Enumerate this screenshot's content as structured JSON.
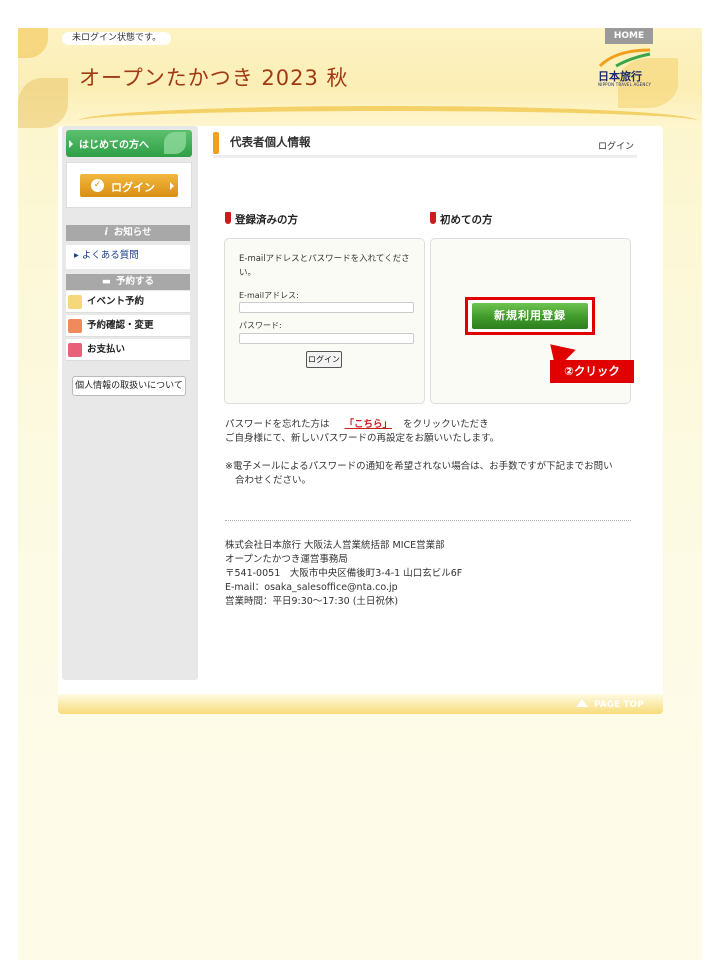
{
  "header": {
    "login_status": "未ログイン状態です。",
    "site_title": "オープンたかつき 2023 秋",
    "home_label": "HOME",
    "brand_name": "日本旅行",
    "brand_sub": "NIPPON TRAVEL AGENCY"
  },
  "sidebar": {
    "first_time_label": "はじめての方へ",
    "login_label": "ログイン",
    "news_heading": "お知らせ",
    "faq_label": "よくある質問",
    "reserve_heading": "予約する",
    "items": [
      {
        "label": "イベント予約",
        "icon": "event-icon"
      },
      {
        "label": "予約確認・変更",
        "icon": "check-icon"
      },
      {
        "label": "お支払い",
        "icon": "payment-icon"
      }
    ],
    "privacy_label": "個人情報の取扱いについて"
  },
  "main": {
    "title": "代表者個人情報",
    "breadcrumb": "ログイン",
    "registered": {
      "heading": "登録済みの方",
      "description": "E-mailアドレスとパスワードを入れてください。",
      "email_label": "E-mailアドレス:",
      "password_label": "パスワード:",
      "email_value": "",
      "password_value": "",
      "login_button": "ログイン"
    },
    "new_user": {
      "heading": "初めての方",
      "register_button": "新規利用登録",
      "annotation": "②クリック"
    },
    "forgot_pre": "パスワードを忘れた方は",
    "forgot_link": "「こちら」",
    "forgot_post": "をクリックいただき",
    "forgot_line2": "ご自身様にて、新しいパスワードの再設定をお願いいたします。",
    "notice_line1": "※電子メールによるパスワードの通知を希望されない場合は、お手数ですが下記までお問い",
    "notice_line2": "合わせください。",
    "company": [
      "株式会社日本旅行 大阪法人営業統括部 MICE営業部",
      "オープンたかつき運営事務局",
      "〒541-0051　大阪市中央区備後町3-4-1 山口玄ビル6F",
      "E-mail：osaka_salesoffice@nta.co.jp",
      "営業時間：平日9:30～17:30 (土日祝休)"
    ]
  },
  "footer": {
    "page_top": "PAGE TOP"
  },
  "colors": {
    "accent_red": "#e00000",
    "title_brown": "#a03a14",
    "register_green": "#3f9a2a",
    "login_orange": "#d88f12"
  }
}
